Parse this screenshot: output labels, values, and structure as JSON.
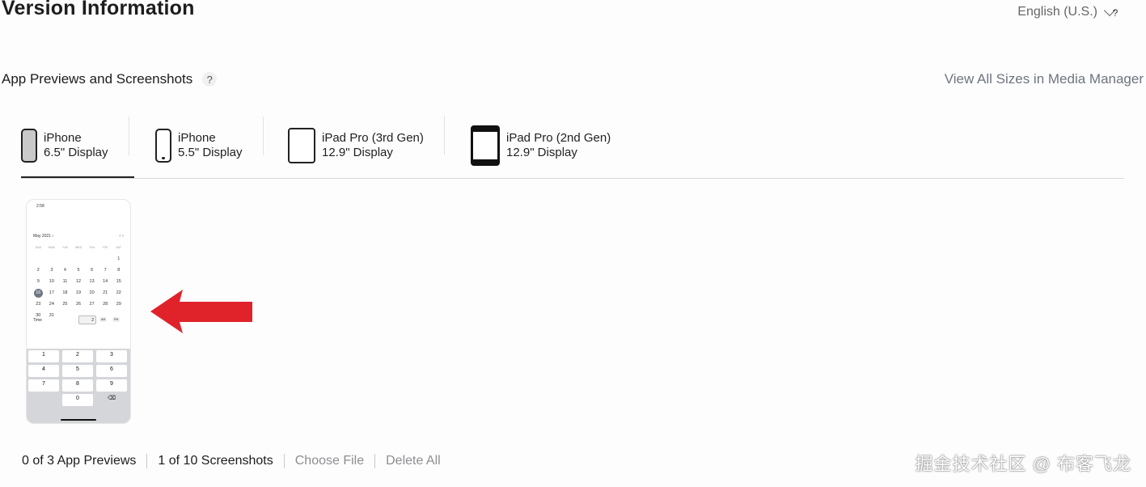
{
  "header": {
    "title": "Version Information",
    "language": "English (U.S.)",
    "help": "?"
  },
  "section": {
    "label": "App Previews and Screenshots",
    "help": "?",
    "view_all": "View All Sizes in Media Manager"
  },
  "tabs": [
    {
      "line1": "iPhone",
      "line2": "6.5\" Display",
      "icon": "iphone-x-icon",
      "selected": true
    },
    {
      "line1": "iPhone",
      "line2": "5.5\" Display",
      "icon": "iphone-icon",
      "selected": false
    },
    {
      "line1": "iPad Pro (3rd Gen)",
      "line2": "12.9\" Display",
      "icon": "ipad-pro-3rd-gen-icon",
      "selected": false
    },
    {
      "line1": "iPad Pro (2nd Gen)",
      "line2": "12.9\" Display",
      "icon": "ipad-pro-2nd-gen-icon",
      "selected": false
    }
  ],
  "screenshot": {
    "status_time": "2:58",
    "month": "May 2021 ›",
    "nav": "‹   ›",
    "weekdays": [
      "SUN",
      "MON",
      "TUE",
      "WED",
      "THU",
      "FRI",
      "SAT"
    ],
    "weeks": [
      [
        "",
        "",
        "",
        "",
        "",
        "",
        "1"
      ],
      [
        "2",
        "3",
        "4",
        "5",
        "6",
        "7",
        "8"
      ],
      [
        "9",
        "10",
        "11",
        "12",
        "13",
        "14",
        "15"
      ],
      [
        "16",
        "17",
        "18",
        "19",
        "20",
        "21",
        "22"
      ],
      [
        "23",
        "24",
        "25",
        "26",
        "27",
        "28",
        "29"
      ],
      [
        "30",
        "31",
        "",
        "",
        "",
        "",
        ""
      ]
    ],
    "selected_day": "16",
    "time_label": "Time",
    "time_value": "2",
    "am": "AM",
    "pm": "PM",
    "keys": [
      "1",
      "2",
      "3",
      "4",
      "5",
      "6",
      "7",
      "8",
      "9",
      "0",
      "⌫"
    ]
  },
  "footer": {
    "previews": "0 of 3 App Previews",
    "screenshots": "1 of 10 Screenshots",
    "choose_file": "Choose File",
    "delete_all": "Delete All"
  },
  "watermark": "掘金技术社区 @ 布客飞龙",
  "colors": {
    "arrow": "#e0232b",
    "link_gray": "#8e8e93",
    "selected_day": "#6f7684"
  }
}
